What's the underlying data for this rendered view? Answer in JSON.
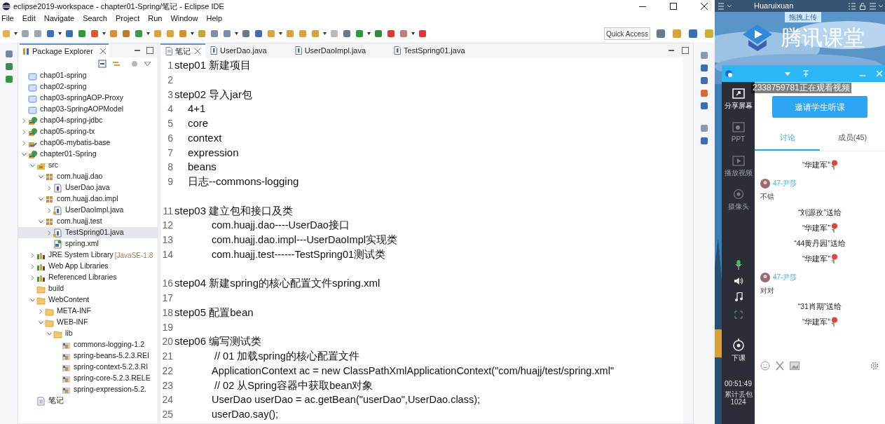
{
  "window": {
    "title": "eclipse2019-workspace - chapter01-Spring/笔记 - Eclipse IDE"
  },
  "menu": [
    "File",
    "Edit",
    "Navigate",
    "Search",
    "Project",
    "Run",
    "Window",
    "Help"
  ],
  "quick_access": {
    "placeholder": "Quick Access"
  },
  "package_explorer": {
    "title": "Package Explorer",
    "tree": [
      {
        "label": "chap01-spring",
        "kind": "closed-project",
        "selected": false
      },
      {
        "label": "chap02-spring",
        "kind": "closed-project",
        "selected": false
      },
      {
        "label": "chap03-springAOP-Proxy",
        "kind": "closed-project",
        "selected": false
      },
      {
        "label": "chap03-SpringAOPModel",
        "kind": "closed-project",
        "selected": false
      },
      {
        "label": "chap04-spring-jdbc",
        "kind": "spring-project",
        "expanded": false,
        "selected": false
      },
      {
        "label": "chap05-spring-tx",
        "kind": "spring-project",
        "expanded": false,
        "selected": false
      },
      {
        "label": "chap06-mybatis-base",
        "kind": "java-project",
        "expanded": false,
        "selected": false
      },
      {
        "label": "chapter01-Spring",
        "kind": "spring-project",
        "expanded": true,
        "selected": false,
        "children": [
          {
            "label": "src",
            "kind": "source",
            "expanded": true,
            "selected": false,
            "children": [
              {
                "label": "com.huajj.dao",
                "kind": "package",
                "expanded": true,
                "selected": false,
                "children": [
                  {
                    "label": "UserDao.java",
                    "kind": "interface",
                    "expanded": false,
                    "selected": false
                  }
                ]
              },
              {
                "label": "com.huajj.dao.impl",
                "kind": "package",
                "expanded": true,
                "selected": false,
                "children": [
                  {
                    "label": "UserDaoImpl.java",
                    "kind": "class",
                    "expanded": false,
                    "selected": false
                  }
                ]
              },
              {
                "label": "com.huajj.test",
                "kind": "package",
                "expanded": true,
                "selected": false,
                "children": [
                  {
                    "label": "TestSpring01.java",
                    "kind": "class",
                    "expanded": false,
                    "selected": true
                  },
                  {
                    "label": "spring.xml",
                    "kind": "xml",
                    "selected": false
                  }
                ]
              }
            ]
          },
          {
            "label": "JRE System Library",
            "detail": "[JavaSE-1.8",
            "kind": "library",
            "expanded": false,
            "selected": false
          },
          {
            "label": "Web App Libraries",
            "kind": "library",
            "expanded": false,
            "selected": false
          },
          {
            "label": "Referenced Libraries",
            "kind": "library",
            "expanded": false,
            "selected": false
          },
          {
            "label": "build",
            "kind": "folder",
            "selected": false
          },
          {
            "label": "WebContent",
            "kind": "folder",
            "expanded": true,
            "selected": false,
            "children": [
              {
                "label": "META-INF",
                "kind": "folder",
                "expanded": false,
                "selected": false
              },
              {
                "label": "WEB-INF",
                "kind": "folder",
                "expanded": true,
                "selected": false,
                "children": [
                  {
                    "label": "lib",
                    "kind": "folder",
                    "expanded": true,
                    "selected": false,
                    "children": [
                      {
                        "label": "commons-logging-1.2",
                        "kind": "jar",
                        "selected": false
                      },
                      {
                        "label": "spring-beans-5.2.3.REI",
                        "kind": "jar",
                        "selected": false
                      },
                      {
                        "label": "spring-context-5.2.3.RI",
                        "kind": "jar",
                        "selected": false
                      },
                      {
                        "label": "spring-core-5.2.3.RELE",
                        "kind": "jar",
                        "selected": false
                      },
                      {
                        "label": "spring-expression-5.2.",
                        "kind": "jar",
                        "selected": false
                      }
                    ]
                  }
                ]
              }
            ]
          },
          {
            "label": "笔记",
            "kind": "text-file",
            "selected": false
          }
        ]
      }
    ]
  },
  "editor": {
    "tabs": [
      {
        "label": "笔记",
        "kind": "text",
        "selected": true
      },
      {
        "label": "UserDao.java",
        "kind": "java",
        "selected": false
      },
      {
        "label": "UserDaoImpl.java",
        "kind": "java",
        "selected": false
      },
      {
        "label": "TestSpring01.java",
        "kind": "java",
        "selected": false
      }
    ],
    "lines": [
      {
        "number": "1",
        "kind": "step",
        "text": "step01 新建项目"
      },
      {
        "number": "2",
        "kind": "blank"
      },
      {
        "number": "3",
        "kind": "step",
        "text": "step02 导入jar包"
      },
      {
        "number": "4",
        "kind": "item",
        "text": "4+1"
      },
      {
        "number": "5",
        "kind": "item",
        "text": "core"
      },
      {
        "number": "6",
        "kind": "item",
        "text": "context"
      },
      {
        "number": "7",
        "kind": "item",
        "text": "expression"
      },
      {
        "number": "8",
        "kind": "item",
        "text": "beans"
      },
      {
        "number": "9",
        "kind": "item",
        "text": "日志--commons-logging"
      },
      {
        "kind": "blank"
      },
      {
        "number": "11",
        "kind": "step",
        "text": "step03 建立包和接口及类"
      },
      {
        "number": "12",
        "kind": "code",
        "text": "com.huajj.dao----UserDao接口"
      },
      {
        "number": "13",
        "kind": "code",
        "text": "com.huajj.dao.impl---UserDaoImpl实现类"
      },
      {
        "number": "14",
        "kind": "code",
        "text": "com.huajj.test------TestSpring01测试类"
      },
      {
        "kind": "blank"
      },
      {
        "number": "16",
        "kind": "step",
        "text": "step04 新建spring的核心配置文件spring.xml"
      },
      {
        "number": "17",
        "kind": "blank"
      },
      {
        "number": "18",
        "kind": "step",
        "text": "step05 配置bean"
      },
      {
        "number": "19",
        "kind": "blank"
      },
      {
        "number": "20",
        "kind": "step",
        "text": "step06 编写测试类"
      },
      {
        "number": "21",
        "kind": "code",
        "text": " // 01 加载spring的核心配置文件"
      },
      {
        "number": "22",
        "kind": "code",
        "text": "ApplicationContext ac = new ClassPathXmlApplicationContext(\"com/huajj/test/spring.xml\""
      },
      {
        "number": "23",
        "kind": "code",
        "text": " // 02 从Spring容器中获取bean对象"
      },
      {
        "number": "24",
        "kind": "code",
        "text": "UserDao userDao = ac.getBean(\"userDao\",UserDao.class);"
      },
      {
        "number": "25",
        "kind": "code",
        "text": "userDao.say();"
      }
    ]
  },
  "classroom": {
    "user": "Huaruixuan",
    "upload_button": "拖拽上传",
    "logo": "腾讯课堂",
    "viewer_notice": "2338759781正在观看视频",
    "tools": [
      {
        "label": "分享屏幕",
        "kind": "share",
        "disabled": false
      },
      {
        "label": "PPT",
        "kind": "ppt",
        "disabled": true
      },
      {
        "label": "播放视频",
        "kind": "video",
        "disabled": true
      },
      {
        "label": "摄像头",
        "kind": "camera",
        "disabled": true
      }
    ],
    "mic_on": true,
    "end_class": "下课",
    "timer": "00:51:49",
    "packet_loss_label": "累计丢包",
    "packet_loss": "1024",
    "invite_button": "邀请学生听课",
    "tabs": [
      {
        "label": "讨论",
        "selected": true
      },
      {
        "label": "成员(45)",
        "selected": false
      }
    ],
    "messages": [
      {
        "kind": "gift",
        "recipient": "“华建军”"
      },
      {
        "kind": "chat",
        "user": "47-尹莎",
        "text": "不错"
      },
      {
        "kind": "gift",
        "sender": "“刘源孜”送给",
        "recipient": "“华建军”"
      },
      {
        "kind": "gift",
        "sender": "“44黄丹园”送给",
        "recipient": "“华建军”"
      },
      {
        "kind": "chat",
        "user": "47-尹莎",
        "text": "对对"
      },
      {
        "kind": "gift",
        "sender": "“31肖期”送给",
        "recipient": "“华建军”"
      }
    ]
  }
}
